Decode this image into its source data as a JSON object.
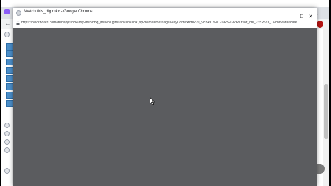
{
  "popup": {
    "title": "Watch this_dig.mkv - Google Chrome",
    "url": "https://blackboard.com/webapps/bbw-my-mso/bbg_mso/plugins/adv-link/link.jsp?name=message&keyContextId=220_9834919-01-1925-1926cursor_id=_2352523_1&md5sid=a8aaf...",
    "controls": {
      "minimize": "—",
      "maximize": "☐",
      "close": "✕"
    }
  },
  "background_window": {
    "favicon_color": "#8b5cf6",
    "back_icon": "←",
    "ext_icon": "⋮",
    "avatar_color": "#b31412",
    "controls": {
      "minimize": "—",
      "maximize": "☐",
      "close": "✕"
    }
  },
  "colors": {
    "popup_content_bg": "#5b5c5f",
    "sidebar_item": "#4b8fca"
  }
}
